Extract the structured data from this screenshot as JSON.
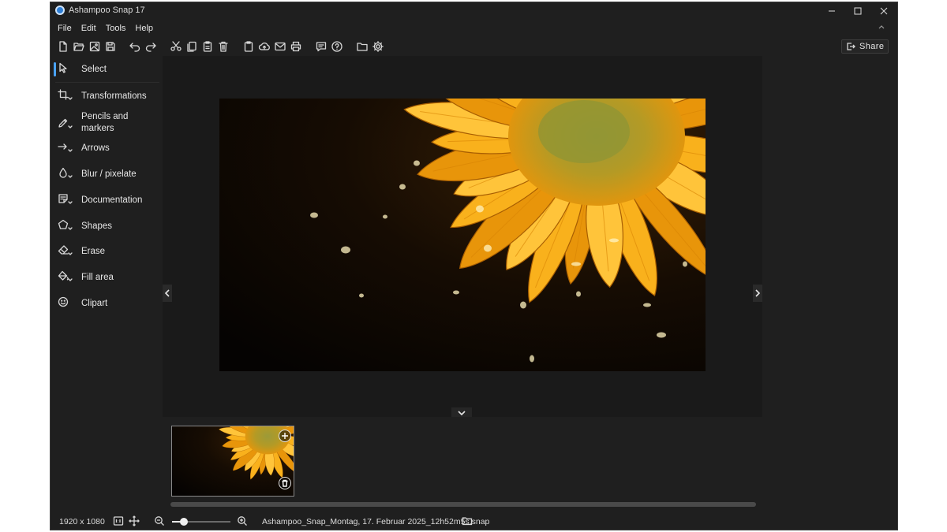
{
  "window": {
    "title": "Ashampoo Snap 17",
    "controls": [
      "minimize-icon",
      "maximize-icon",
      "close-icon"
    ]
  },
  "menu": {
    "items": [
      {
        "label": "File"
      },
      {
        "label": "Edit"
      },
      {
        "label": "Tools"
      },
      {
        "label": "Help"
      }
    ],
    "collapse_icon": "chevron-up-icon"
  },
  "toolbar": {
    "icons": [
      "new-file-icon",
      "open-folder-icon",
      "open-image-icon",
      "save-icon",
      "undo-icon",
      "redo-icon",
      "cut-icon",
      "copy-icon",
      "paste-icon",
      "delete-icon",
      "clipboard-icon",
      "upload-cloud-icon",
      "email-icon",
      "print-icon",
      "feedback-icon",
      "help-icon",
      "folder-icon",
      "settings-icon"
    ],
    "share_label": "Share"
  },
  "tools": [
    {
      "label": "Select",
      "icon": "cursor-icon",
      "selected": true
    },
    {
      "label": "Transformations",
      "icon": "crop-icon"
    },
    {
      "label": "Pencils and markers",
      "icon": "pencil-icon"
    },
    {
      "label": "Arrows",
      "icon": "arrow-icon"
    },
    {
      "label": "Blur / pixelate",
      "icon": "blur-icon"
    },
    {
      "label": "Documentation",
      "icon": "documentation-icon"
    },
    {
      "label": "Shapes",
      "icon": "shapes-icon"
    },
    {
      "label": "Erase",
      "icon": "eraser-icon"
    },
    {
      "label": "Fill area",
      "icon": "fill-bucket-icon"
    },
    {
      "label": "Clipart",
      "icon": "smiley-icon"
    }
  ],
  "colors": {
    "background": "#1f1f1f",
    "canvas": "#1a1a1a",
    "accent": "#4aa3ff",
    "petal": "#f5a50f"
  },
  "status": {
    "dimensions": "1920 x 1080",
    "zoom_fraction": 0.2,
    "filename": "Ashampoo_Snap_Montag, 17. Februar 2025_12h52m5s.snap"
  }
}
